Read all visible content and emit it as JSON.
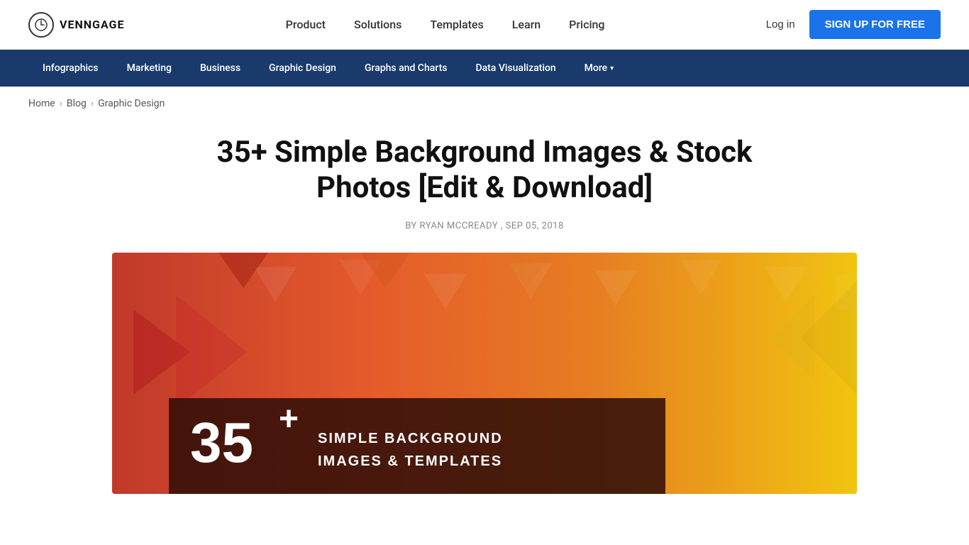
{
  "brand": {
    "logo_symbol": "⏱",
    "logo_text": "VENNGAGE"
  },
  "top_nav": {
    "items": [
      {
        "label": "Product",
        "id": "product"
      },
      {
        "label": "Solutions",
        "id": "solutions"
      },
      {
        "label": "Templates",
        "id": "templates"
      },
      {
        "label": "Learn",
        "id": "learn"
      },
      {
        "label": "Pricing",
        "id": "pricing"
      }
    ],
    "login_label": "Log in",
    "signup_label": "SIGN UP FOR FREE"
  },
  "secondary_nav": {
    "items": [
      {
        "label": "Infographics",
        "id": "infographics"
      },
      {
        "label": "Marketing",
        "id": "marketing"
      },
      {
        "label": "Business",
        "id": "business"
      },
      {
        "label": "Graphic Design",
        "id": "graphic-design"
      },
      {
        "label": "Graphs and Charts",
        "id": "graphs-charts"
      },
      {
        "label": "Data Visualization",
        "id": "data-viz"
      }
    ],
    "more_label": "More"
  },
  "breadcrumb": {
    "home": "Home",
    "blog": "Blog",
    "category": "Graphic Design"
  },
  "article": {
    "title": "35+ Simple Background Images & Stock Photos [Edit & Download]",
    "author": "RYAN MCCREADY",
    "date": "SEP 05, 2018",
    "meta_by": "BY",
    "meta_comma": ","
  },
  "hero": {
    "big_number": "35",
    "plus_sign": "+",
    "sub_line1": "SIMPLE BACKGROUND",
    "sub_line2": "IMAGES & TEMPLATES"
  }
}
